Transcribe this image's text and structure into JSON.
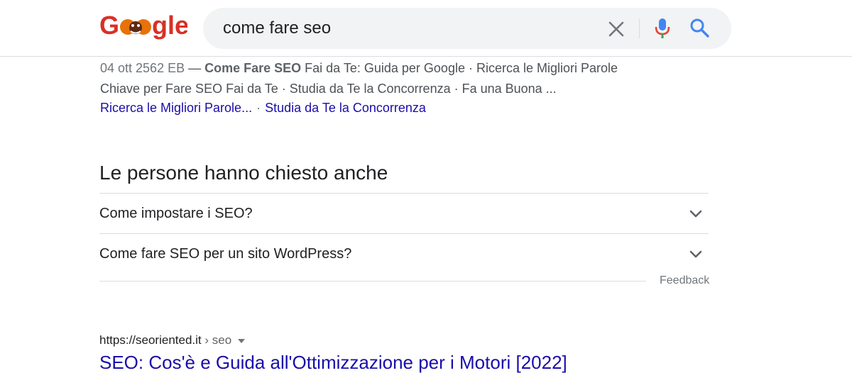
{
  "logo": {
    "text": "Google"
  },
  "search": {
    "query": "come fare seo"
  },
  "snippet": {
    "date": "04 ott 2562 EB",
    "dash": " — ",
    "bold": "Come Fare SEO",
    "text1": " Fai da Te: Guida per Google · Ricerca le Migliori Parole",
    "text2": "Chiave per Fare SEO Fai da Te · Studia da Te la Concorrenza · Fa una Buona ..."
  },
  "sitelinks": [
    {
      "label": "Ricerca le Migliori Parole..."
    },
    {
      "label": "Studia da Te la Concorrenza"
    }
  ],
  "sitelink_separator": "·",
  "paa": {
    "title": "Le persone hanno chiesto anche",
    "questions": [
      {
        "label": "Come impostare i SEO?"
      },
      {
        "label": "Come fare SEO per un sito WordPress?"
      }
    ],
    "feedback": "Feedback"
  },
  "result": {
    "domain": "https://seoriented.it",
    "path": " › seo",
    "title": "SEO: Cos'è e Guida all'Ottimizzazione per i Motori [2022]"
  },
  "colors": {
    "link": "#1a0dab",
    "mic_blue": "#4285f4",
    "mic_red": "#ea4335",
    "logo_red": "#d93025"
  }
}
